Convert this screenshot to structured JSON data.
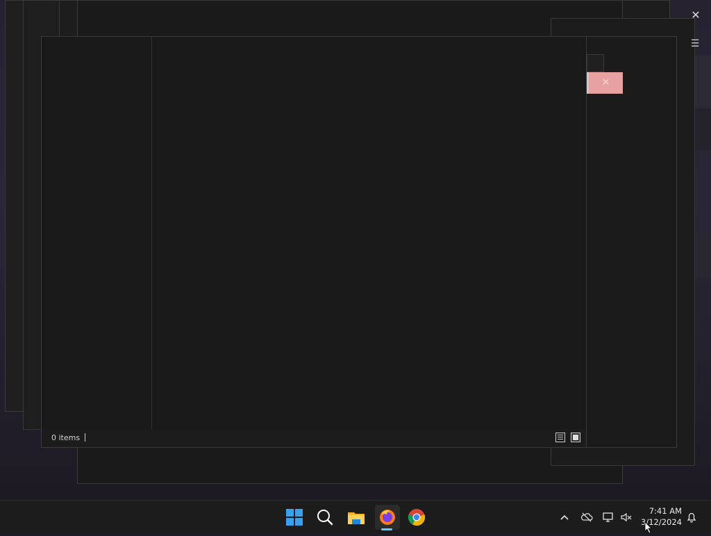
{
  "explorer": {
    "status": {
      "items_count": "0 items"
    }
  },
  "taskbar": {
    "pinned": [
      {
        "name": "Start",
        "icon": "windows-logo-icon"
      },
      {
        "name": "Search",
        "icon": "search-icon"
      },
      {
        "name": "File Explorer",
        "icon": "folder-icon"
      },
      {
        "name": "Firefox",
        "icon": "firefox-icon",
        "active": true
      },
      {
        "name": "Google Chrome",
        "icon": "chrome-icon"
      }
    ],
    "tray": {
      "icons": [
        "chevron-up-icon",
        "onedrive-cloud-icon",
        "network-icon",
        "volume-muted-icon",
        "notification-bell-icon"
      ],
      "time": "7:41 AM",
      "date": "3/12/2024"
    }
  },
  "colors": {
    "accent": "#60cdff",
    "window_bg": "#191919",
    "close_hover": "#e8a1a1",
    "taskbar_bg": "#1c1c1c"
  }
}
